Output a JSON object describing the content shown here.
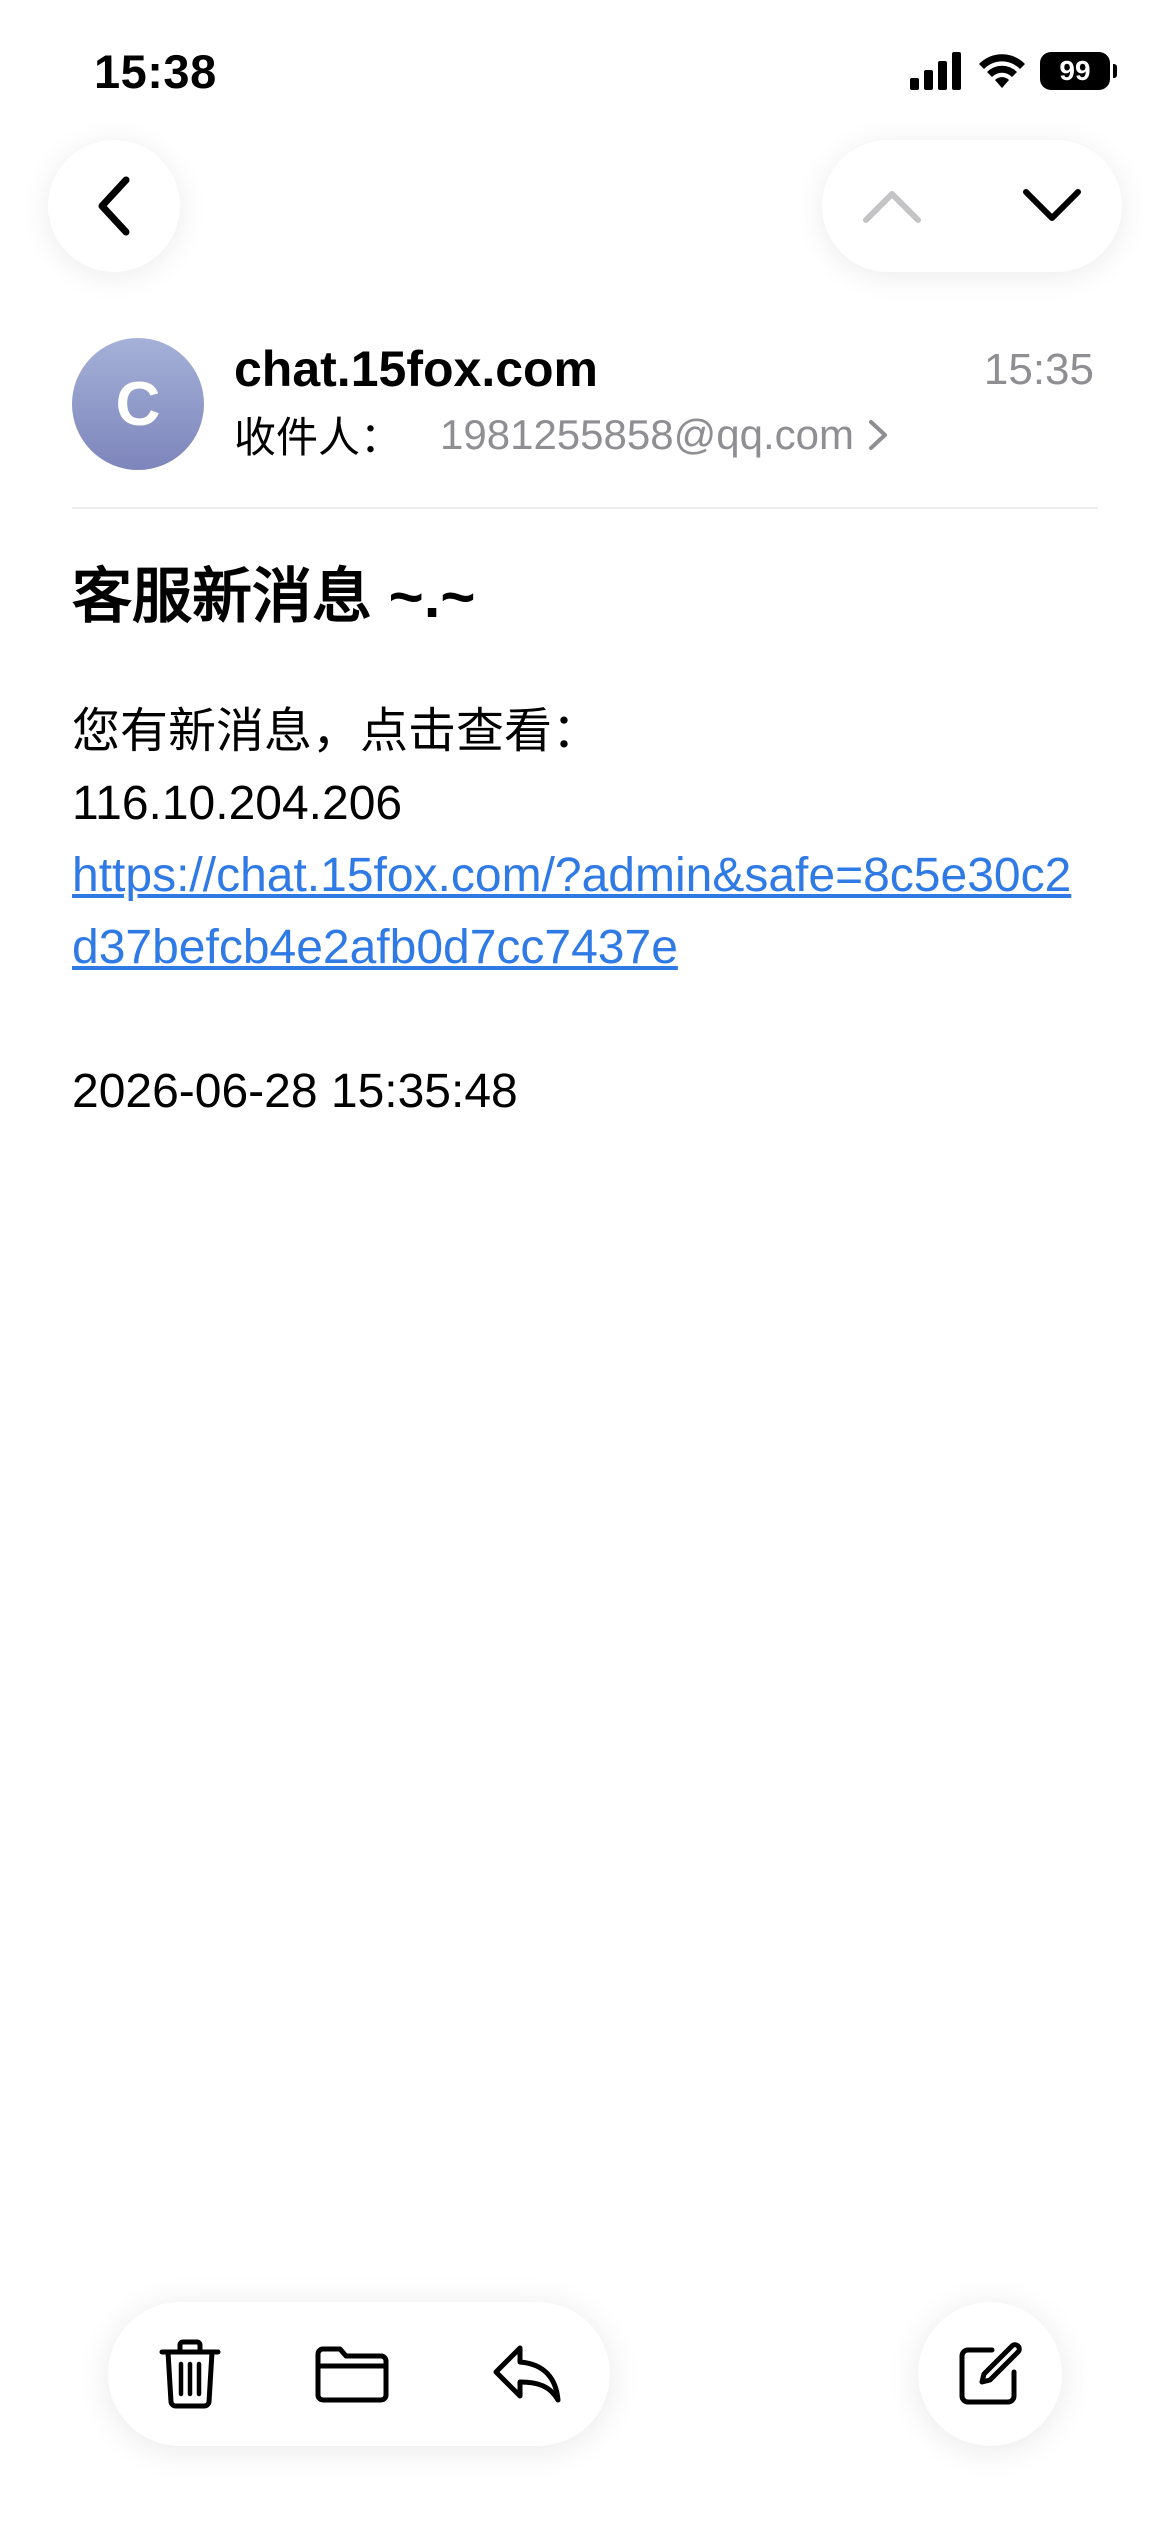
{
  "status_bar": {
    "time": "15:38",
    "battery": "99",
    "icons": [
      "signal-icon",
      "wifi-icon",
      "battery-icon"
    ]
  },
  "nav": {
    "back_icon": "chevron-left-icon",
    "prev_icon": "chevron-up-icon",
    "next_icon": "chevron-down-icon"
  },
  "email": {
    "avatar_letter": "C",
    "sender": "chat.15fox.com",
    "time": "15:35",
    "recipient_label": "收件人：",
    "recipient_address": "1981255858@qq.com",
    "subject": "客服新消息 ~.~",
    "body": {
      "line1": "您有新消息，点击查看：",
      "line2": "116.10.204.206",
      "link": "https://chat.15fox.com/?admin&safe=8c5e30c2d37befcb4e2afb0d7cc7437e",
      "date": "2026-06-28 15:35:48"
    }
  },
  "toolbar": {
    "items": [
      "trash-icon",
      "folder-icon",
      "reply-icon"
    ],
    "compose_icon": "compose-icon"
  },
  "colors": {
    "link": "#2f7ae5",
    "secondary_text": "#8e8e93",
    "avatar_top": "#a5b1d8",
    "avatar_bottom": "#7d85bb"
  }
}
